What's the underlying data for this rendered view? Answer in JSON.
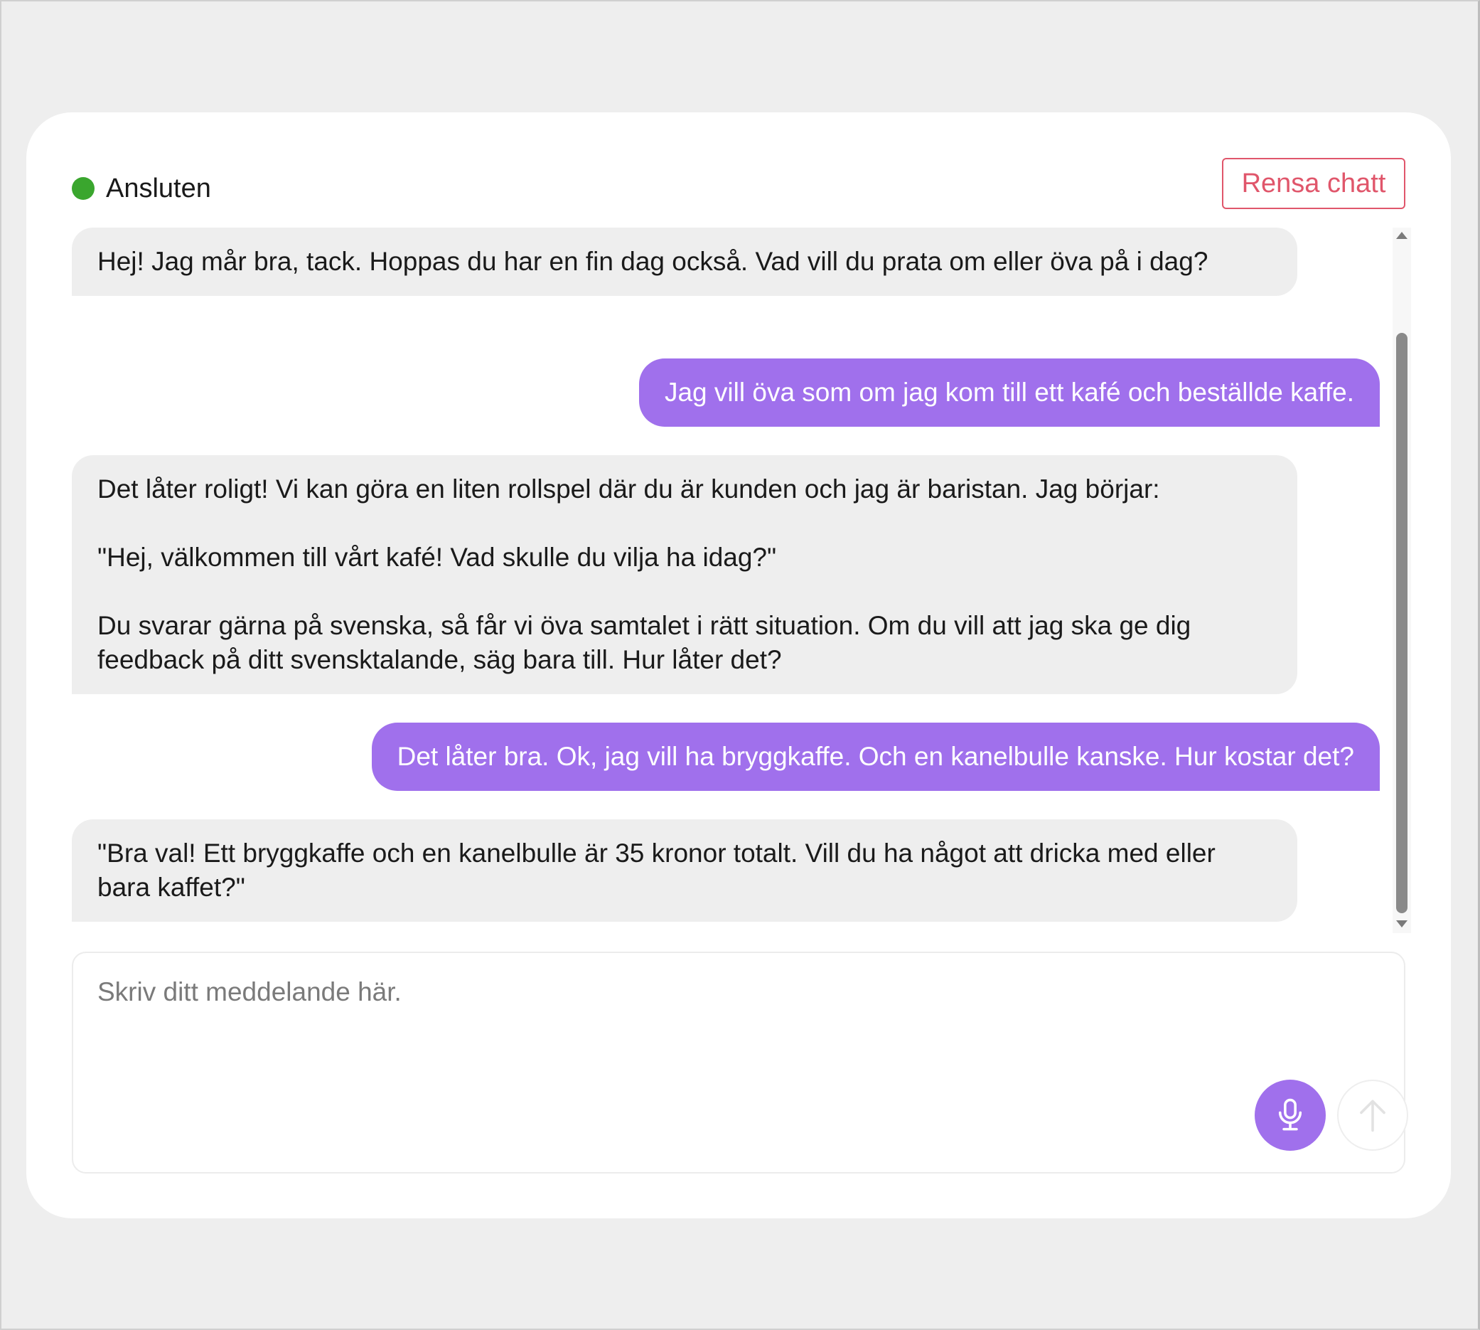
{
  "header": {
    "status_label": "Ansluten",
    "status_color": "#3aa62e",
    "clear_button_label": "Rensa chatt"
  },
  "messages": [
    {
      "role": "assistant",
      "text": "Hej! Jag mår bra, tack. Hoppas du har en fin dag också. Vad vill du prata om eller öva på i dag?"
    },
    {
      "role": "user",
      "text": "Jag vill öva som om jag kom till ett kafé och beställde kaffe."
    },
    {
      "role": "assistant",
      "text": "Det låter roligt! Vi kan göra en liten rollspel där du är kunden och jag är baristan. Jag börjar:\n\n\"Hej, välkommen till vårt kafé! Vad skulle du vilja ha idag?\"\n\nDu svarar gärna på svenska, så får vi öva samtalet i rätt situation. Om du vill att jag ska ge dig feedback på ditt svensktalande, säg bara till. Hur låter det?"
    },
    {
      "role": "user",
      "text": "Det låter bra. Ok, jag vill ha bryggkaffe. Och en kanelbulle kanske. Hur kostar det?"
    },
    {
      "role": "assistant",
      "text": "\"Bra val! Ett bryggkaffe och en kanelbulle är 35 kronor totalt. Vill du ha något att dricka med eller bara kaffet?\""
    }
  ],
  "composer": {
    "placeholder": "Skriv ditt meddelande här.",
    "value": "",
    "mic_icon": "microphone-icon",
    "send_icon": "arrow-up-icon"
  },
  "colors": {
    "accent": "#a070ec",
    "danger": "#e0566b",
    "bot_bubble": "#eeeeee"
  }
}
